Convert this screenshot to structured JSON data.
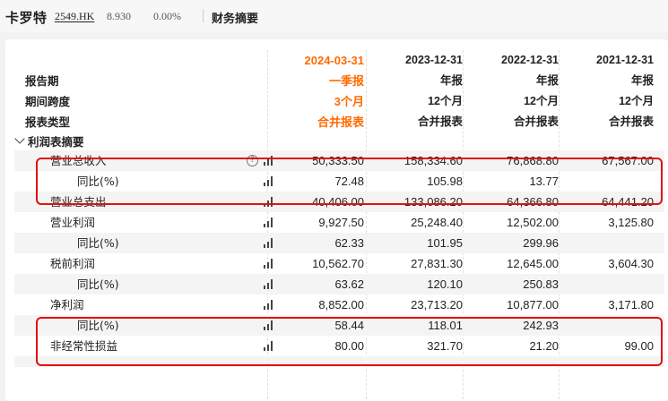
{
  "header": {
    "stock_name": "卡罗特",
    "stock_code": "2549.HK",
    "price": "8.930",
    "change": "0.00%",
    "section": "财务摘要"
  },
  "columns": [
    "2024-03-31",
    "2023-12-31",
    "2022-12-31",
    "2021-12-31"
  ],
  "meta_rows": [
    {
      "label": "报告期",
      "values": [
        "一季报",
        "年报",
        "年报",
        "年报"
      ]
    },
    {
      "label": "期间跨度",
      "values": [
        "3个月",
        "12个月",
        "12个月",
        "12个月"
      ]
    },
    {
      "label": "报表类型",
      "values": [
        "合并报表",
        "合并报表",
        "合并报表",
        "合并报表"
      ]
    }
  ],
  "group_label": "利润表摘要",
  "rows": [
    {
      "label": "营业总收入",
      "values": [
        "50,333.50",
        "158,334.60",
        "76,868.80",
        "67,567.00"
      ],
      "help": true
    },
    {
      "label": "同比(%)",
      "values": [
        "72.48",
        "105.98",
        "13.77",
        ""
      ]
    },
    {
      "label": "营业总支出",
      "values": [
        "40,406.00",
        "133,086.20",
        "64,366.80",
        "64,441.20"
      ]
    },
    {
      "label": "营业利润",
      "values": [
        "9,927.50",
        "25,248.40",
        "12,502.00",
        "3,125.80"
      ]
    },
    {
      "label": "同比(%)",
      "values": [
        "62.33",
        "101.95",
        "299.96",
        ""
      ]
    },
    {
      "label": "税前利润",
      "values": [
        "10,562.70",
        "27,831.30",
        "12,645.00",
        "3,604.30"
      ]
    },
    {
      "label": "同比(%)",
      "values": [
        "63.62",
        "120.10",
        "250.83",
        ""
      ]
    },
    {
      "label": "净利润",
      "values": [
        "8,852.00",
        "23,713.20",
        "10,877.00",
        "3,171.80"
      ]
    },
    {
      "label": "同比(%)",
      "values": [
        "58.44",
        "118.01",
        "242.93",
        ""
      ]
    },
    {
      "label": "非经常性损益",
      "values": [
        "80.00",
        "321.70",
        "21.20",
        "99.00"
      ]
    }
  ],
  "colors": {
    "accent": "#ff6a00",
    "highlight": "#e01111"
  }
}
